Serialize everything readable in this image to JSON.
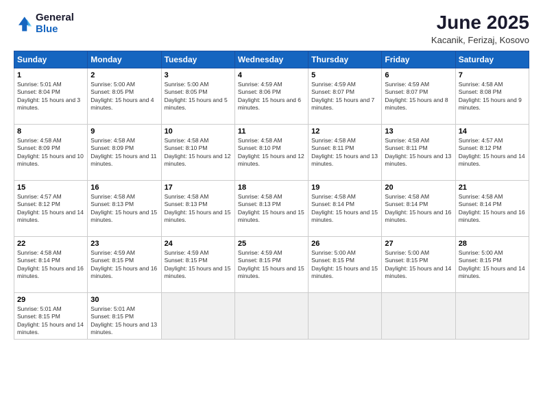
{
  "logo": {
    "line1": "General",
    "line2": "Blue"
  },
  "title": "June 2025",
  "location": "Kacanik, Ferizaj, Kosovo",
  "days_of_week": [
    "Sunday",
    "Monday",
    "Tuesday",
    "Wednesday",
    "Thursday",
    "Friday",
    "Saturday"
  ],
  "weeks": [
    [
      {
        "num": "1",
        "sunrise": "5:01 AM",
        "sunset": "8:04 PM",
        "daylight": "15 hours and 3 minutes."
      },
      {
        "num": "2",
        "sunrise": "5:00 AM",
        "sunset": "8:05 PM",
        "daylight": "15 hours and 4 minutes."
      },
      {
        "num": "3",
        "sunrise": "5:00 AM",
        "sunset": "8:05 PM",
        "daylight": "15 hours and 5 minutes."
      },
      {
        "num": "4",
        "sunrise": "4:59 AM",
        "sunset": "8:06 PM",
        "daylight": "15 hours and 6 minutes."
      },
      {
        "num": "5",
        "sunrise": "4:59 AM",
        "sunset": "8:07 PM",
        "daylight": "15 hours and 7 minutes."
      },
      {
        "num": "6",
        "sunrise": "4:59 AM",
        "sunset": "8:07 PM",
        "daylight": "15 hours and 8 minutes."
      },
      {
        "num": "7",
        "sunrise": "4:58 AM",
        "sunset": "8:08 PM",
        "daylight": "15 hours and 9 minutes."
      }
    ],
    [
      {
        "num": "8",
        "sunrise": "4:58 AM",
        "sunset": "8:09 PM",
        "daylight": "15 hours and 10 minutes."
      },
      {
        "num": "9",
        "sunrise": "4:58 AM",
        "sunset": "8:09 PM",
        "daylight": "15 hours and 11 minutes."
      },
      {
        "num": "10",
        "sunrise": "4:58 AM",
        "sunset": "8:10 PM",
        "daylight": "15 hours and 12 minutes."
      },
      {
        "num": "11",
        "sunrise": "4:58 AM",
        "sunset": "8:10 PM",
        "daylight": "15 hours and 12 minutes."
      },
      {
        "num": "12",
        "sunrise": "4:58 AM",
        "sunset": "8:11 PM",
        "daylight": "15 hours and 13 minutes."
      },
      {
        "num": "13",
        "sunrise": "4:58 AM",
        "sunset": "8:11 PM",
        "daylight": "15 hours and 13 minutes."
      },
      {
        "num": "14",
        "sunrise": "4:57 AM",
        "sunset": "8:12 PM",
        "daylight": "15 hours and 14 minutes."
      }
    ],
    [
      {
        "num": "15",
        "sunrise": "4:57 AM",
        "sunset": "8:12 PM",
        "daylight": "15 hours and 14 minutes."
      },
      {
        "num": "16",
        "sunrise": "4:58 AM",
        "sunset": "8:13 PM",
        "daylight": "15 hours and 15 minutes."
      },
      {
        "num": "17",
        "sunrise": "4:58 AM",
        "sunset": "8:13 PM",
        "daylight": "15 hours and 15 minutes."
      },
      {
        "num": "18",
        "sunrise": "4:58 AM",
        "sunset": "8:13 PM",
        "daylight": "15 hours and 15 minutes."
      },
      {
        "num": "19",
        "sunrise": "4:58 AM",
        "sunset": "8:14 PM",
        "daylight": "15 hours and 15 minutes."
      },
      {
        "num": "20",
        "sunrise": "4:58 AM",
        "sunset": "8:14 PM",
        "daylight": "15 hours and 16 minutes."
      },
      {
        "num": "21",
        "sunrise": "4:58 AM",
        "sunset": "8:14 PM",
        "daylight": "15 hours and 16 minutes."
      }
    ],
    [
      {
        "num": "22",
        "sunrise": "4:58 AM",
        "sunset": "8:14 PM",
        "daylight": "15 hours and 16 minutes."
      },
      {
        "num": "23",
        "sunrise": "4:59 AM",
        "sunset": "8:15 PM",
        "daylight": "15 hours and 16 minutes."
      },
      {
        "num": "24",
        "sunrise": "4:59 AM",
        "sunset": "8:15 PM",
        "daylight": "15 hours and 15 minutes."
      },
      {
        "num": "25",
        "sunrise": "4:59 AM",
        "sunset": "8:15 PM",
        "daylight": "15 hours and 15 minutes."
      },
      {
        "num": "26",
        "sunrise": "5:00 AM",
        "sunset": "8:15 PM",
        "daylight": "15 hours and 15 minutes."
      },
      {
        "num": "27",
        "sunrise": "5:00 AM",
        "sunset": "8:15 PM",
        "daylight": "15 hours and 14 minutes."
      },
      {
        "num": "28",
        "sunrise": "5:00 AM",
        "sunset": "8:15 PM",
        "daylight": "15 hours and 14 minutes."
      }
    ],
    [
      {
        "num": "29",
        "sunrise": "5:01 AM",
        "sunset": "8:15 PM",
        "daylight": "15 hours and 14 minutes."
      },
      {
        "num": "30",
        "sunrise": "5:01 AM",
        "sunset": "8:15 PM",
        "daylight": "15 hours and 13 minutes."
      },
      null,
      null,
      null,
      null,
      null
    ]
  ]
}
